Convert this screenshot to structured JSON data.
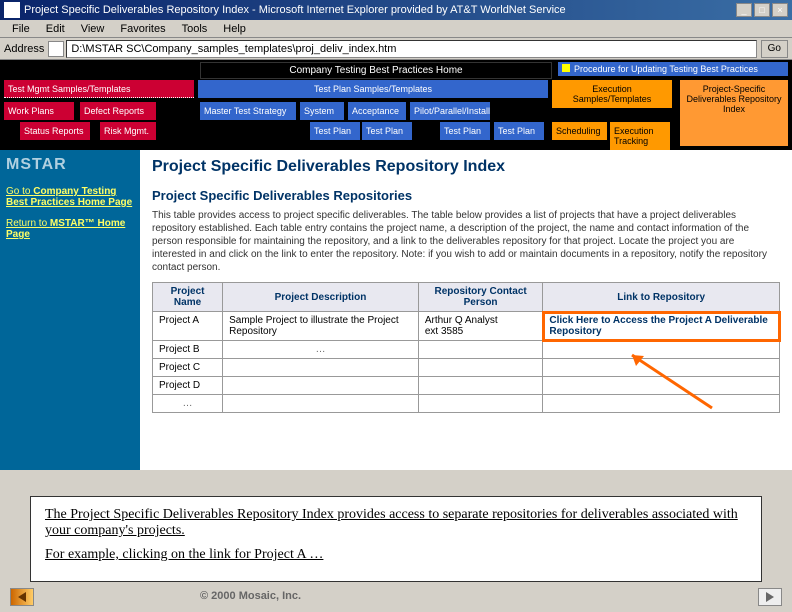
{
  "window": {
    "title": "Project Specific Deliverables Repository Index - Microsoft Internet Explorer provided by AT&T WorldNet Service"
  },
  "menu": {
    "file": "File",
    "edit": "Edit",
    "view": "View",
    "fav": "Favorites",
    "tools": "Tools",
    "help": "Help"
  },
  "address": {
    "label": "Address",
    "value": "D:\\MSTAR SC\\Company_samples_templates\\proj_deliv_index.htm",
    "go": "Go"
  },
  "nav": {
    "home": "Company Testing Best Practices Home",
    "proc": "Procedure for Updating Testing Best Practices",
    "testmgmt": "Test Mgmt Samples/Templates",
    "workplans": "Work Plans",
    "defrep": "Defect Reports",
    "status": "Status Reports",
    "risk": "Risk Mgmt.",
    "testplan_hdr": "Test Plan Samples/Templates",
    "master": "Master Test Strategy",
    "system": "System",
    "accept": "Acceptance",
    "pilot": "Pilot/Parallel/Install",
    "tp": "Test Plan",
    "exec_hdr": "Execution Samples/Templates",
    "sched": "Scheduling",
    "exectrack": "Execution Tracking",
    "psd": "Project-Specific Deliverables Repository Index"
  },
  "sidebar": {
    "logo": "MSTAR",
    "link1_pre": "Go to ",
    "link1_bold": "Company Testing Best Practices Home Page",
    "link2_pre": "Return to ",
    "link2_bold": "MSTAR™ Home Page"
  },
  "page": {
    "h1": "Project Specific Deliverables Repository Index",
    "h2": "Project Specific Deliverables Repositories",
    "intro": "This table provides access to project specific deliverables. The table below provides a list of projects that have a project deliverables repository established. Each table entry contains the project name, a description of the project, the name and contact information of the person responsible for maintaining the repository, and a link to the deliverables repository for that project. Locate the project you are interested in and click on the link to enter the repository. Note: if you wish to add or maintain documents in a repository, notify the repository contact person."
  },
  "table": {
    "headers": {
      "name": "Project Name",
      "desc": "Project Description",
      "contact": "Repository Contact Person",
      "link": "Link to Repository"
    },
    "rows": [
      {
        "name": "Project A",
        "desc": "Sample Project to illustrate the Project Repository",
        "contact": "Arthur Q Analyst\next 3585",
        "link": "Click Here to Access the Project A Deliverable Repository"
      },
      {
        "name": "Project B",
        "desc": "…",
        "contact": "",
        "link": ""
      },
      {
        "name": "Project C",
        "desc": "",
        "contact": "",
        "link": ""
      },
      {
        "name": "Project D",
        "desc": "",
        "contact": "",
        "link": ""
      }
    ],
    "dots": "…"
  },
  "callout": {
    "p1": "The Project Specific Deliverables Repository Index provides access to separate repositories for deliverables associated with your company's projects.",
    "p2": "For example, clicking on the link for Project A …"
  },
  "copyright": "© 2000 Mosaic, Inc."
}
